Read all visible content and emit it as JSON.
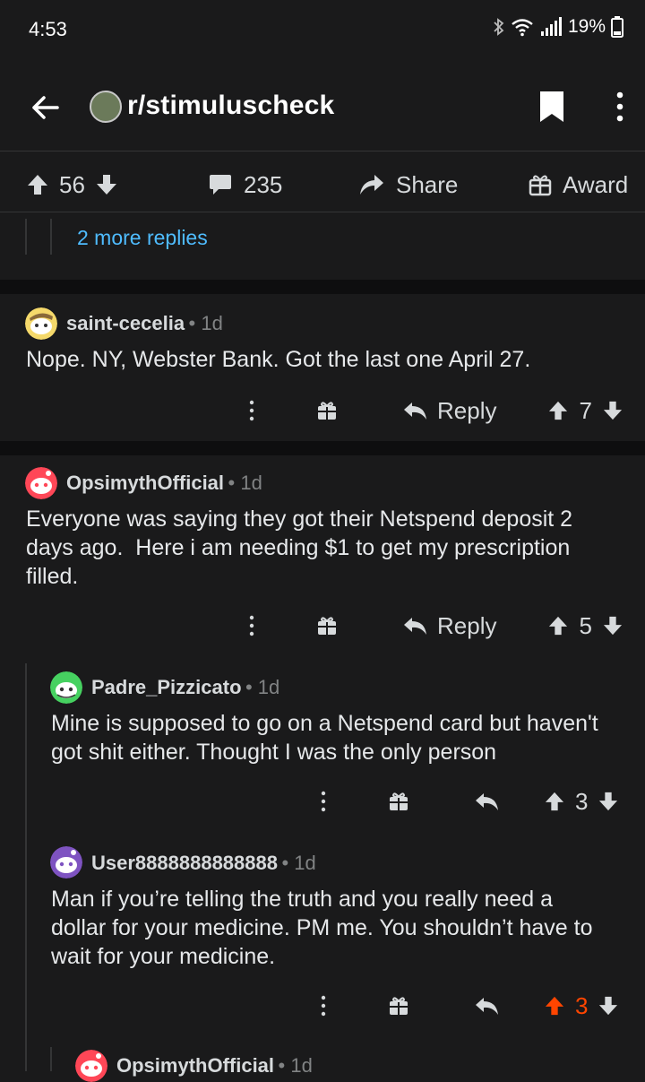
{
  "status": {
    "time": "4:53",
    "battery": "19%"
  },
  "header": {
    "subreddit": "r/stimuluscheck"
  },
  "post_actions": {
    "score": "56",
    "comments": "235",
    "share": "Share",
    "award": "Award"
  },
  "more_replies": "2 more replies",
  "comments": [
    {
      "user": "saint-cecelia",
      "age": "1d",
      "body": "Nope. NY, Webster Bank. Got the last one April 27.",
      "reply": "Reply",
      "score": "7"
    },
    {
      "user": "OpsimythOfficial",
      "age": "1d",
      "body_lines": [
        "Everyone was saying they got their Netspend deposit 2",
        "days ago.  Here i am needing $1 to get my prescription",
        "filled."
      ],
      "reply": "Reply",
      "score": "5"
    },
    {
      "user": "Padre_Pizzicato",
      "age": "1d",
      "body_lines": [
        "Mine is supposed to go on a Netspend card but haven't",
        "got shit either. Thought I was the only person"
      ],
      "score": "3"
    },
    {
      "user": "User8888888888888",
      "age": "1d",
      "body_lines": [
        "Man if you’re telling the truth and you really need a",
        "dollar for your medicine. PM me. You shouldn’t have to",
        "wait for your medicine."
      ],
      "score": "3",
      "upvoted": true
    },
    {
      "user": "OpsimythOfficial",
      "age": "1d"
    }
  ],
  "colors": {
    "upvote": "#ff4500",
    "link": "#4fbcff",
    "background": "#1a1a1b"
  }
}
